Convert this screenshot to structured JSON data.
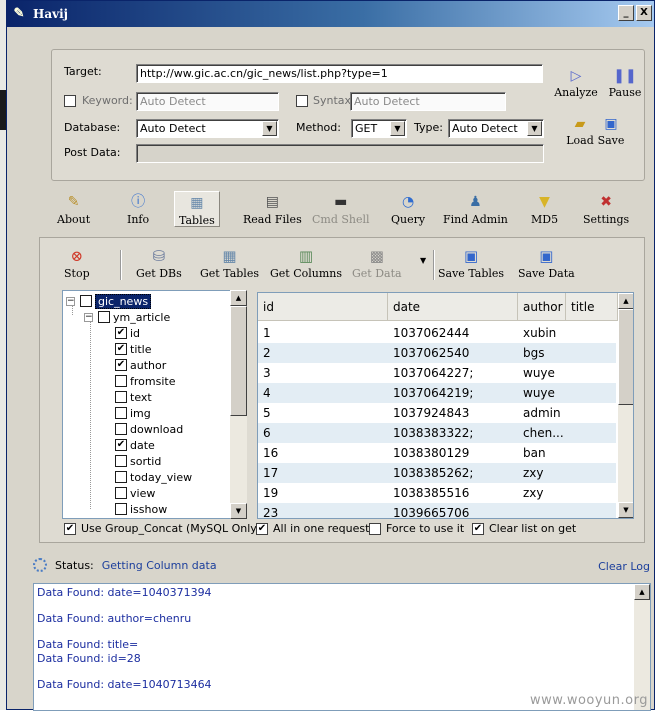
{
  "window": {
    "title": "Havij",
    "buttons": {
      "minimize": "_",
      "close": "X"
    }
  },
  "target": {
    "target_label": "Target:",
    "target_value": "http://ww.gic.ac.cn/gic_news/list.php?type=1",
    "keyword_label": "Keyword:",
    "keyword_value": "Auto Detect",
    "syntax_label": "Syntax:",
    "syntax_value": "Auto Detect",
    "database_label": "Database:",
    "database_value": "Auto Detect",
    "method_label": "Method:",
    "method_value": "GET",
    "type_label": "Type:",
    "type_value": "Auto Detect",
    "postdata_label": "Post Data:",
    "analyze_label": "Analyze",
    "pause_label": "Pause",
    "load_label": "Load",
    "save_label": "Save"
  },
  "toolbar": {
    "tabs": [
      {
        "label": "About"
      },
      {
        "label": "Info"
      },
      {
        "label": "Tables"
      },
      {
        "label": "Read Files"
      },
      {
        "label": "Cmd Shell"
      },
      {
        "label": "Query"
      },
      {
        "label": "Find Admin"
      },
      {
        "label": "MD5"
      },
      {
        "label": "Settings"
      }
    ]
  },
  "tables_panel": {
    "actions": {
      "stop": "Stop",
      "get_dbs": "Get DBs",
      "get_tables": "Get Tables",
      "get_columns": "Get Columns",
      "get_data": "Get Data",
      "save_tables": "Save Tables",
      "save_data": "Save Data"
    },
    "tree": {
      "db": "gic_news",
      "table": "ym_article",
      "columns": [
        {
          "name": "id",
          "checked": true
        },
        {
          "name": "title",
          "checked": true
        },
        {
          "name": "author",
          "checked": true
        },
        {
          "name": "fromsite",
          "checked": false
        },
        {
          "name": "text",
          "checked": false
        },
        {
          "name": "img",
          "checked": false
        },
        {
          "name": "download",
          "checked": false
        },
        {
          "name": "date",
          "checked": true
        },
        {
          "name": "sortid",
          "checked": false
        },
        {
          "name": "today_view",
          "checked": false
        },
        {
          "name": "view",
          "checked": false
        },
        {
          "name": "isshow",
          "checked": false
        }
      ]
    },
    "grid": {
      "headers": [
        "id",
        "date",
        "author",
        "title"
      ],
      "rows": [
        [
          "1",
          "1037062444",
          "xubin",
          ""
        ],
        [
          "2",
          "1037062540",
          "bgs",
          ""
        ],
        [
          "3",
          "1037064227;",
          "wuye",
          ""
        ],
        [
          "4",
          "1037064219;",
          "wuye",
          ""
        ],
        [
          "5",
          "1037924843",
          "admin",
          ""
        ],
        [
          "6",
          "1038383322;",
          "chen...",
          ""
        ],
        [
          "16",
          "1038380129",
          "ban",
          ""
        ],
        [
          "17",
          "1038385262;",
          "zxy",
          ""
        ],
        [
          "19",
          "1038385516",
          "zxy",
          ""
        ],
        [
          "23",
          "1039665706",
          "",
          ""
        ]
      ]
    },
    "options": {
      "group_concat": "Use Group_Concat (MySQL Only)",
      "all_in_one": "All in one request.",
      "force": "Force to use it",
      "clear_list": "Clear list on get"
    }
  },
  "status": {
    "label": "Status:",
    "value": "Getting Column data",
    "clear_log": "Clear Log"
  },
  "log": [
    "Data Found: date=1040371394",
    "Data Found: author=chenru",
    "Data Found: title=",
    "Data Found: id=28",
    "Data Found: date=1040713464"
  ],
  "watermark": "www.wooyun.org"
}
